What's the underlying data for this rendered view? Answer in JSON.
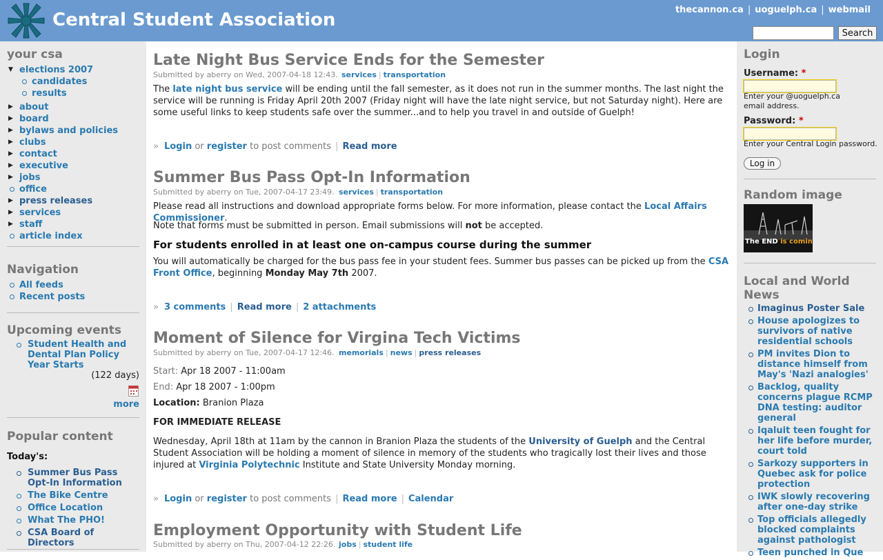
{
  "header": {
    "site_name": "Central Student Association",
    "links": [
      "thecannon.ca",
      "uoguelph.ca",
      "webmail"
    ],
    "search_button": "Search",
    "search_value": ""
  },
  "left": {
    "your_csa": {
      "title": "your csa",
      "elections": "elections 2007",
      "sub": [
        "candidates",
        "results"
      ],
      "items": [
        "about",
        "board",
        "bylaws and policies",
        "clubs",
        "contact",
        "executive",
        "jobs",
        "office",
        "press releases",
        "services",
        "staff",
        "article index"
      ]
    },
    "navigation": {
      "title": "Navigation",
      "items": [
        "All feeds",
        "Recent posts"
      ]
    },
    "events": {
      "title": "Upcoming events",
      "event": "Student Health and Dental Plan Policy Year Starts",
      "days": "(122 days)",
      "more": "more"
    },
    "popular": {
      "title": "Popular content",
      "today": "Today's:",
      "items": [
        "Summer Bus Pass Opt-In Information",
        "The Bike Centre",
        "Office Location",
        "What The PHO!",
        "CSA Board of Directors"
      ]
    }
  },
  "posts": {
    "p1": {
      "title": "Late Night Bus Service Ends for the Semester",
      "submitted": "Submitted by aberry on Wed, 2007-04-18 12:43.",
      "terms": [
        "services",
        "transportation"
      ],
      "body_pre": "The ",
      "body_link": "late night bus service",
      "body_post": " will be ending until the fall semester, as it does not run in the summer months. The last night the service will be running is Friday April 20th 2007 (Friday night will have the late night service, but not Saturday night). Here are some useful links to keep students safe over the summer...and to help you travel in and outside of Guelph!",
      "login": "Login",
      "or": "or",
      "register": "register",
      "to_post": "to post comments",
      "read_more": "Read more"
    },
    "p2": {
      "title": "Summer Bus Pass Opt-In Information",
      "submitted": "Submitted by aberry on Tue, 2007-04-17 23:49.",
      "terms": [
        "services",
        "transportation"
      ],
      "para1_pre": "Please read all instructions and download appropriate forms below. For more information, please contact the ",
      "para1_link": "Local Affairs Commissioner",
      "para1_post": ".",
      "para2_pre": "Note that forms must be submitted in person. Email submissions will ",
      "para2_bold": "not",
      "para2_post": " be accepted.",
      "subhead": "For students enrolled in at least one on-campus course during the summer",
      "para3_pre": "You will automatically be charged for the bus pass fee in your student fees. Summer bus passes can be picked up from the ",
      "para3_link": "CSA Front Office",
      "para3_mid": ", beginning ",
      "para3_bold": "Monday May 7th",
      "para3_post": " 2007.",
      "comments": "3 comments",
      "read_more": "Read more",
      "attachments": "2 attachments"
    },
    "p3": {
      "title": "Moment of Silence for Virgina Tech Victims",
      "submitted": "Submitted by aberry on Tue, 2007-04-17 12:46.",
      "terms": [
        "memorials",
        "news",
        "press releases"
      ],
      "start_label": "Start:",
      "start_value": "Apr 18 2007 - 11:00am",
      "end_label": "End:",
      "end_value": "Apr 18 2007 - 1:00pm",
      "location_label": "Location:",
      "location_value": "Branion Plaza",
      "release": "FOR IMMEDIATE RELEASE",
      "body_pre": "Wednesday, April 18th at 11am by the cannon in Branion Plaza the students of the ",
      "body_link1": "University of Guelph",
      "body_mid": " and the Central Student Association will be holding a moment of silence in memory of the students who tragically lost their lives and those injured at ",
      "body_link2": "Virginia Polytechnic",
      "body_post": " Institute and State University Monday morning.",
      "login": "Login",
      "or": "or",
      "register": "register",
      "to_post": "to post comments",
      "read_more": "Read more",
      "calendar": "Calendar"
    },
    "p4": {
      "title": "Employment Opportunity with Student Life",
      "submitted": "Submitted by aberry on Thu, 2007-04-12 22:26.",
      "terms": [
        "jobs",
        "student life"
      ]
    }
  },
  "right": {
    "login": {
      "title": "Login",
      "username_label": "Username:",
      "username_desc": "Enter your @uoguelph.ca email address.",
      "password_label": "Password:",
      "password_desc": "Enter your Central Login password.",
      "button": "Log in",
      "required": "*"
    },
    "random": {
      "title": "Random image",
      "caption_a": "The END",
      "caption_b": " is coming!"
    },
    "news": {
      "title": "Local and World News",
      "items": [
        "Imaginus Poster Sale",
        "House apologizes to survivors of native residential schools",
        "PM invites Dion to distance himself from May's 'Nazi analogies'",
        "Backlog, quality concerns plague RCMP DNA testing: auditor general",
        "Iqaluit teen fought for her life before murder, court told",
        "Sarkozy supporters in Quebec ask for police protection",
        "IWK slowly recovering after one-day strike",
        "Top officials allegedly blocked complaints against pathologist",
        "Teen punched in Que"
      ]
    }
  }
}
